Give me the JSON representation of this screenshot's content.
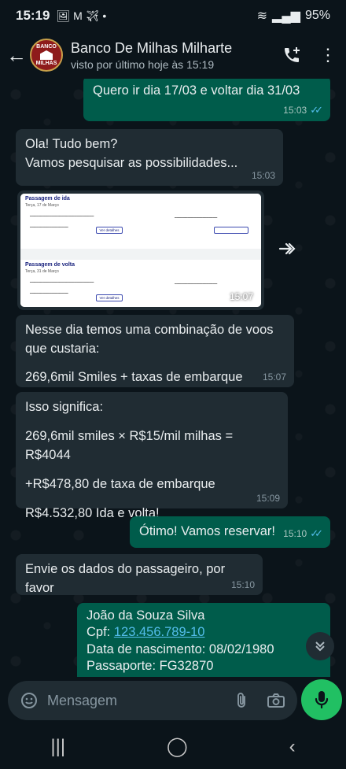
{
  "status": {
    "time": "15:19",
    "left_icons": "🖼 M ✈ •",
    "battery": "95%"
  },
  "header": {
    "name": "Banco De Milhas Milharte",
    "subtitle": "visto por último hoje às 15:19",
    "avatar_line1": "BANCO",
    "avatar_line2": "MILHAS"
  },
  "messages": [
    {
      "text": "Quero ir dia 17/03 e voltar dia 31/03",
      "time": "15:03"
    },
    {
      "line1": "Ola! Tudo bem?",
      "line2": "Vamos pesquisar as possibilidades...",
      "time": "15:03"
    },
    {
      "time": "15:07",
      "ida_title": "Passagem de ida",
      "ida_sub": "Terça, 17 de Março",
      "volta_title": "Passagem de volta",
      "volta_sub": "Terça, 31 de Março",
      "btn": "Ver detalhes"
    },
    {
      "line1": "Nesse dia temos uma combinação de voos",
      "line2": "que custaria:",
      "line3": "269,6mil Smiles + taxas de embarque",
      "time": "15:07"
    },
    {
      "line1": "Isso significa:",
      "line2": "269,6mil smiles × R$15/mil milhas = R$4044",
      "line3": "+R$478,80 de taxa de embarque",
      "line4": "R$4.532,80 Ida e volta!",
      "time": "15:09"
    },
    {
      "text": "Ótimo! Vamos reservar!",
      "time": "15:10"
    },
    {
      "text": "Envie os dados do passageiro, por favor",
      "time": "15:10"
    },
    {
      "line1": "João da Souza Silva",
      "cpf_label": "Cpf: ",
      "cpf_value": "123.456.789-10",
      "line3": "Data de nascimento: 08/02/1980",
      "line4": "Passaporte: FG32870"
    }
  ],
  "composer": {
    "placeholder": "Mensagem"
  },
  "colors": {
    "incoming": "#202c33",
    "outgoing": "#005c4b",
    "accent": "#21c063",
    "link": "#53bdeb"
  }
}
